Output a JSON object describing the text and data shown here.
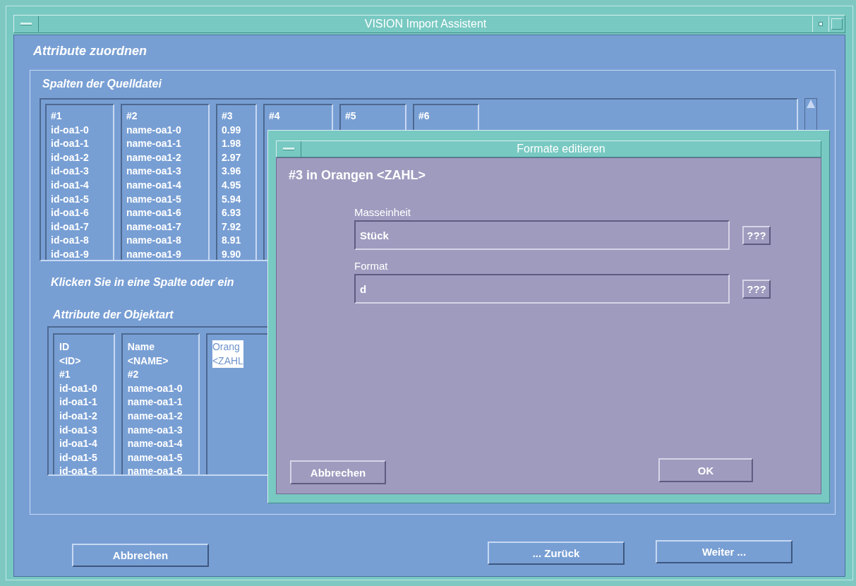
{
  "window": {
    "title": "VISION Import Assistent"
  },
  "heading": "Attribute zuordnen",
  "source_group": {
    "title": "Spalten der Quelldatei",
    "columns": [
      {
        "header": "#1",
        "values": [
          "id-oa1-0",
          "id-oa1-1",
          "id-oa1-2",
          "id-oa1-3",
          "id-oa1-4",
          "id-oa1-5",
          "id-oa1-6",
          "id-oa1-7",
          "id-oa1-8",
          "id-oa1-9"
        ]
      },
      {
        "header": "#2",
        "values": [
          "name-oa1-0",
          "name-oa1-1",
          "name-oa1-2",
          "name-oa1-3",
          "name-oa1-4",
          "name-oa1-5",
          "name-oa1-6",
          "name-oa1-7",
          "name-oa1-8",
          "name-oa1-9"
        ]
      },
      {
        "header": "#3",
        "values": [
          "0.99",
          "1.98",
          "2.97",
          "3.96",
          "4.95",
          "5.94",
          "6.93",
          "7.92",
          "8.91",
          "9.90"
        ]
      },
      {
        "header": "#4"
      },
      {
        "header": "#5"
      },
      {
        "header": "#6"
      }
    ]
  },
  "hint": "Klicken Sie in eine Spalte oder ein",
  "attribute_group": {
    "title": "Attribute der Objektart",
    "columns": [
      {
        "selected": false,
        "lines": [
          "ID",
          "<ID>",
          "#1",
          "id-oa1-0",
          "id-oa1-1",
          "id-oa1-2",
          "id-oa1-3",
          "id-oa1-4",
          "id-oa1-5",
          "id-oa1-6"
        ]
      },
      {
        "selected": false,
        "lines": [
          "Name",
          "<NAME>",
          "#2",
          "name-oa1-0",
          "name-oa1-1",
          "name-oa1-2",
          "name-oa1-3",
          "name-oa1-4",
          "name-oa1-5",
          "name-oa1-6"
        ]
      },
      {
        "selected": true,
        "lines": [
          "Orang",
          "<ZAHL"
        ]
      }
    ]
  },
  "buttons": [
    {
      "label": "Abbrechen"
    },
    {
      "label": "... Zurück"
    },
    {
      "label": "Weiter ..."
    }
  ],
  "dialog": {
    "title": "Formate editieren",
    "heading": "#3 in Orangen <ZAHL>",
    "fields": [
      {
        "label": "Masseinheit",
        "value": "Stück",
        "help": "???"
      },
      {
        "label": "Format",
        "value": "d",
        "help": "???"
      }
    ],
    "buttons": [
      {
        "label": "Abbrechen"
      },
      {
        "label": "OK"
      }
    ]
  }
}
